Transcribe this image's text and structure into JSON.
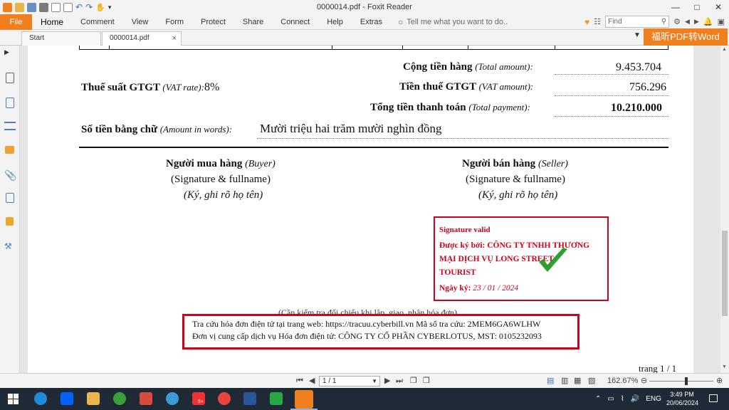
{
  "window": {
    "title": "0000014.pdf - Foxit Reader",
    "minimize": "—",
    "maximize": "□",
    "close": "✕"
  },
  "ribbon": {
    "file_tab": "File",
    "tabs": [
      "Home",
      "Comment",
      "View",
      "Form",
      "Protect",
      "Share",
      "Connect",
      "Help",
      "Extras"
    ],
    "tell_me_placeholder": "Tell me what you want to do..",
    "find_placeholder": "Find"
  },
  "doc_tabs": {
    "start": "Start",
    "current": "0000014.pdf",
    "close_glyph": "×"
  },
  "promo": "福昕PDF转Word",
  "invoice": {
    "total_amount_label": "Cộng tiền hàng",
    "total_amount_en": "(Total amount):",
    "total_amount_value": "9.453.704",
    "vat_rate_label": "Thuế suất GTGT",
    "vat_rate_en": "(VAT rate):",
    "vat_rate_value": "8%",
    "vat_amount_label": "Tiền thuế GTGT",
    "vat_amount_en": "(VAT amount):",
    "vat_amount_value": "756.296",
    "total_payment_label": "Tổng tiền thanh toán",
    "total_payment_en": "(Total payment):",
    "total_payment_value": "10.210.000",
    "amount_words_label": "Số tiền bằng chữ",
    "amount_words_en": "(Amount in words):",
    "amount_words_value": "Mười triệu hai trăm mười nghìn đồng",
    "buyer_label": "Người mua hàng",
    "buyer_en": "(Buyer)",
    "seller_label": "Người bán hàng",
    "seller_en": "(Seller)",
    "signature_fullname": "(Signature & fullname)",
    "sign_vn": "(Ký, ghi rõ họ tên)",
    "signature": {
      "valid": "Signature valid",
      "signed_by_prefix": "Được ký bởi:",
      "company_line1": "CÔNG TY TNHH THƯƠNG",
      "company_line2": "MẠI DỊCH VỤ LONG STREET",
      "company_line3": "TOURIST",
      "date_label": "Ngày ký:",
      "date_value": "23 / 01 / 2024"
    },
    "check_note": "(Cần kiểm tra đối chiếu khi lập, giao, nhận hóa đơn)",
    "lookup_line": "Tra cứu hóa đơn điện tử tại trang web: https://tracuu.cyberbill.vn   Mã số tra cứu: 2MEM6GA6WLHW",
    "provider_line": "Đơn vị cung cấp dịch vụ Hóa đơn điện tử: CÔNG TY CỔ PHẦN CYBERLOTUS, MST: 0105232093",
    "page_footer": "trang 1 / 1"
  },
  "statusbar": {
    "page_indicator": "1 / 1",
    "zoom": "162.67%"
  },
  "taskbar": {
    "lang": "ENG",
    "time": "3:49 PM",
    "date": "20/06/2024",
    "badge": "5+"
  },
  "colors": {
    "accent_orange": "#f0801e",
    "signature_red": "#d0021b",
    "check_green": "#2e9e2e",
    "taskbar": "#1f2a36"
  }
}
